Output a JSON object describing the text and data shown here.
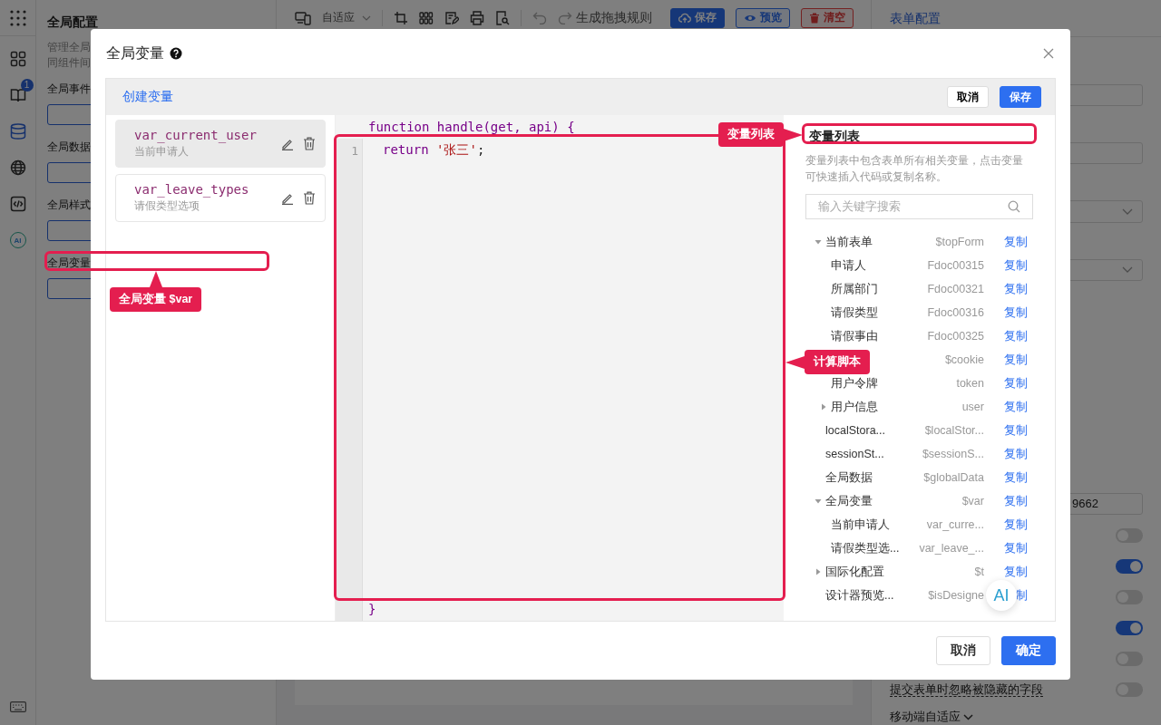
{
  "rail": {
    "items": [
      {
        "kind": "layout",
        "selected": false
      },
      {
        "kind": "book",
        "selected": false,
        "badge": "1"
      },
      {
        "kind": "database",
        "selected": true
      },
      {
        "kind": "globe",
        "selected": false
      },
      {
        "kind": "code",
        "selected": false
      },
      {
        "kind": "ai",
        "selected": false,
        "label": "AI"
      }
    ]
  },
  "config_panel": {
    "title": "全局配置",
    "description_lines": [
      "管理全局",
      "同组件间"
    ],
    "sections": [
      {
        "label": "全局事件"
      },
      {
        "label": "全局数据"
      },
      {
        "label": "全局样式"
      },
      {
        "label": "全局变量"
      }
    ]
  },
  "toolbar": {
    "device_mode": "自适应",
    "rule_button": "生成拖拽规则",
    "buttons": [
      {
        "kind": "primary",
        "label": "保存"
      },
      {
        "kind": "outline",
        "label": "预览"
      },
      {
        "kind": "danger",
        "label": "清空"
      }
    ]
  },
  "form_panel": {
    "title": "表单配置",
    "fields": [
      {
        "kind": "input"
      },
      {
        "kind": "input"
      },
      {
        "kind": "select"
      },
      {
        "kind": "select"
      },
      {
        "kind": "input",
        "value": "9662"
      }
    ],
    "switches": [
      {
        "on": false
      },
      {
        "on": true
      },
      {
        "on": false
      },
      {
        "on": true
      },
      {
        "on": false
      },
      {
        "on": false,
        "label": "提交表单时忽略被隐藏的字段"
      }
    ],
    "section_toggle": "移动端自适应"
  },
  "dialog": {
    "title": "全局变量",
    "toolbar": {
      "create_link": "创建变量",
      "cancel": "取消",
      "save": "保存"
    },
    "variables": [
      {
        "name": "var_current_user",
        "description": "当前申请人",
        "selected": true
      },
      {
        "name": "var_leave_types",
        "description": "请假类型选项",
        "selected": false
      }
    ],
    "editor": {
      "header": "function handle(get, api) {",
      "lines": [
        {
          "number": "1",
          "tokens": [
            {
              "kind": "keyword",
              "text": "return"
            },
            {
              "kind": "string",
              "text": " '张三'"
            },
            {
              "kind": "plain",
              "text": ";"
            }
          ]
        }
      ],
      "footer": "}"
    },
    "variable_panel": {
      "title": "变量列表",
      "description": "变量列表中包含表单所有相关变量，点击变量可快速插入代码或复制名称。",
      "search": {
        "placeholder": "输入关键字搜索"
      },
      "tree": [
        {
          "name": "当前表单",
          "value": "$topForm",
          "copy": "复制",
          "expanded": true,
          "children": [
            {
              "name": "申请人",
              "value": "Fdoc00315",
              "copy": "复制"
            },
            {
              "name": "所属部门",
              "value": "Fdoc00321",
              "copy": "复制"
            },
            {
              "name": "请假类型",
              "value": "Fdoc00316",
              "copy": "复制"
            },
            {
              "name": "请假事由",
              "value": "Fdoc00325",
              "copy": "复制"
            }
          ]
        },
        {
          "value": "$cookie",
          "copy": "复制",
          "children": [
            {
              "name": "用户令牌",
              "value": "token",
              "copy": "复制"
            },
            {
              "name": "用户信息",
              "value": "user",
              "copy": "复制",
              "expanded": false
            }
          ]
        },
        {
          "name": "localStora...",
          "value": "$localStor...",
          "copy": "复制"
        },
        {
          "name": "sessionSt...",
          "value": "$sessionS...",
          "copy": "复制"
        },
        {
          "name": "全局数据",
          "value": "$globalData",
          "copy": "复制"
        },
        {
          "name": "全局变量",
          "value": "$var",
          "copy": "复制",
          "expanded": true,
          "children": [
            {
              "name": "当前申请人",
              "value": "var_curre...",
              "copy": "复制"
            },
            {
              "name": "请假类型选...",
              "value": "var_leave_...",
              "copy": "复制"
            }
          ]
        },
        {
          "name": "国际化配置",
          "value": "$t",
          "copy": "复制",
          "expanded": false
        },
        {
          "name": "设计器预览...",
          "value": "$isDesigne",
          "copy": "制"
        }
      ]
    },
    "footer_buttons": [
      {
        "kind": "default",
        "label": "取消"
      },
      {
        "kind": "primary",
        "label": "确定"
      }
    ]
  },
  "annotations": [
    {
      "text": "全局变量 $var"
    },
    {
      "text": "变量列表"
    },
    {
      "text": "计算脚本"
    }
  ],
  "ai_button": {
    "label": "AI"
  }
}
